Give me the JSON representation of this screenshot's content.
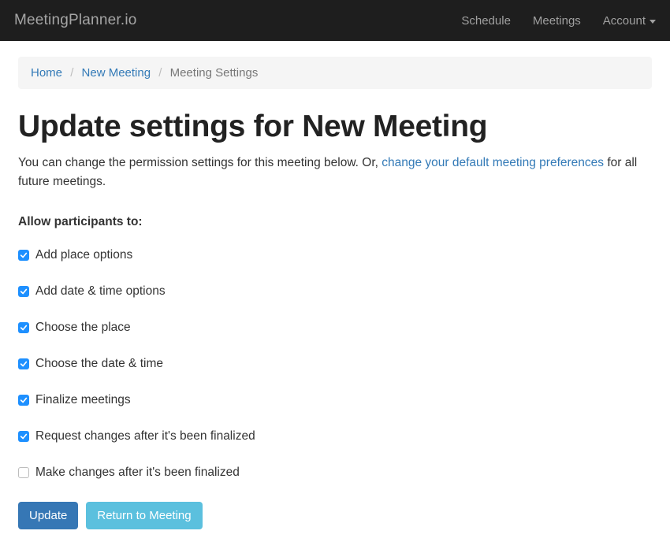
{
  "navbar": {
    "brand": "MeetingPlanner.io",
    "links": [
      {
        "label": "Schedule"
      },
      {
        "label": "Meetings"
      },
      {
        "label": "Account",
        "dropdown": true
      }
    ]
  },
  "breadcrumb": {
    "items": [
      {
        "label": "Home",
        "link": true
      },
      {
        "label": "New Meeting",
        "link": true
      },
      {
        "label": "Meeting Settings",
        "link": false
      }
    ]
  },
  "title": "Update settings for New Meeting",
  "lead": {
    "before": "You can change the permission settings for this meeting below. Or, ",
    "link": "change your default meeting preferences",
    "after": " for all future meetings."
  },
  "section_label": "Allow participants to:",
  "options": [
    {
      "label": "Add place options",
      "checked": true
    },
    {
      "label": "Add date & time options",
      "checked": true
    },
    {
      "label": "Choose the place",
      "checked": true
    },
    {
      "label": "Choose the date & time",
      "checked": true
    },
    {
      "label": "Finalize meetings",
      "checked": true
    },
    {
      "label": "Request changes after it's been finalized",
      "checked": true
    },
    {
      "label": "Make changes after it's been finalized",
      "checked": false
    }
  ],
  "buttons": {
    "update": "Update",
    "return": "Return to Meeting"
  }
}
